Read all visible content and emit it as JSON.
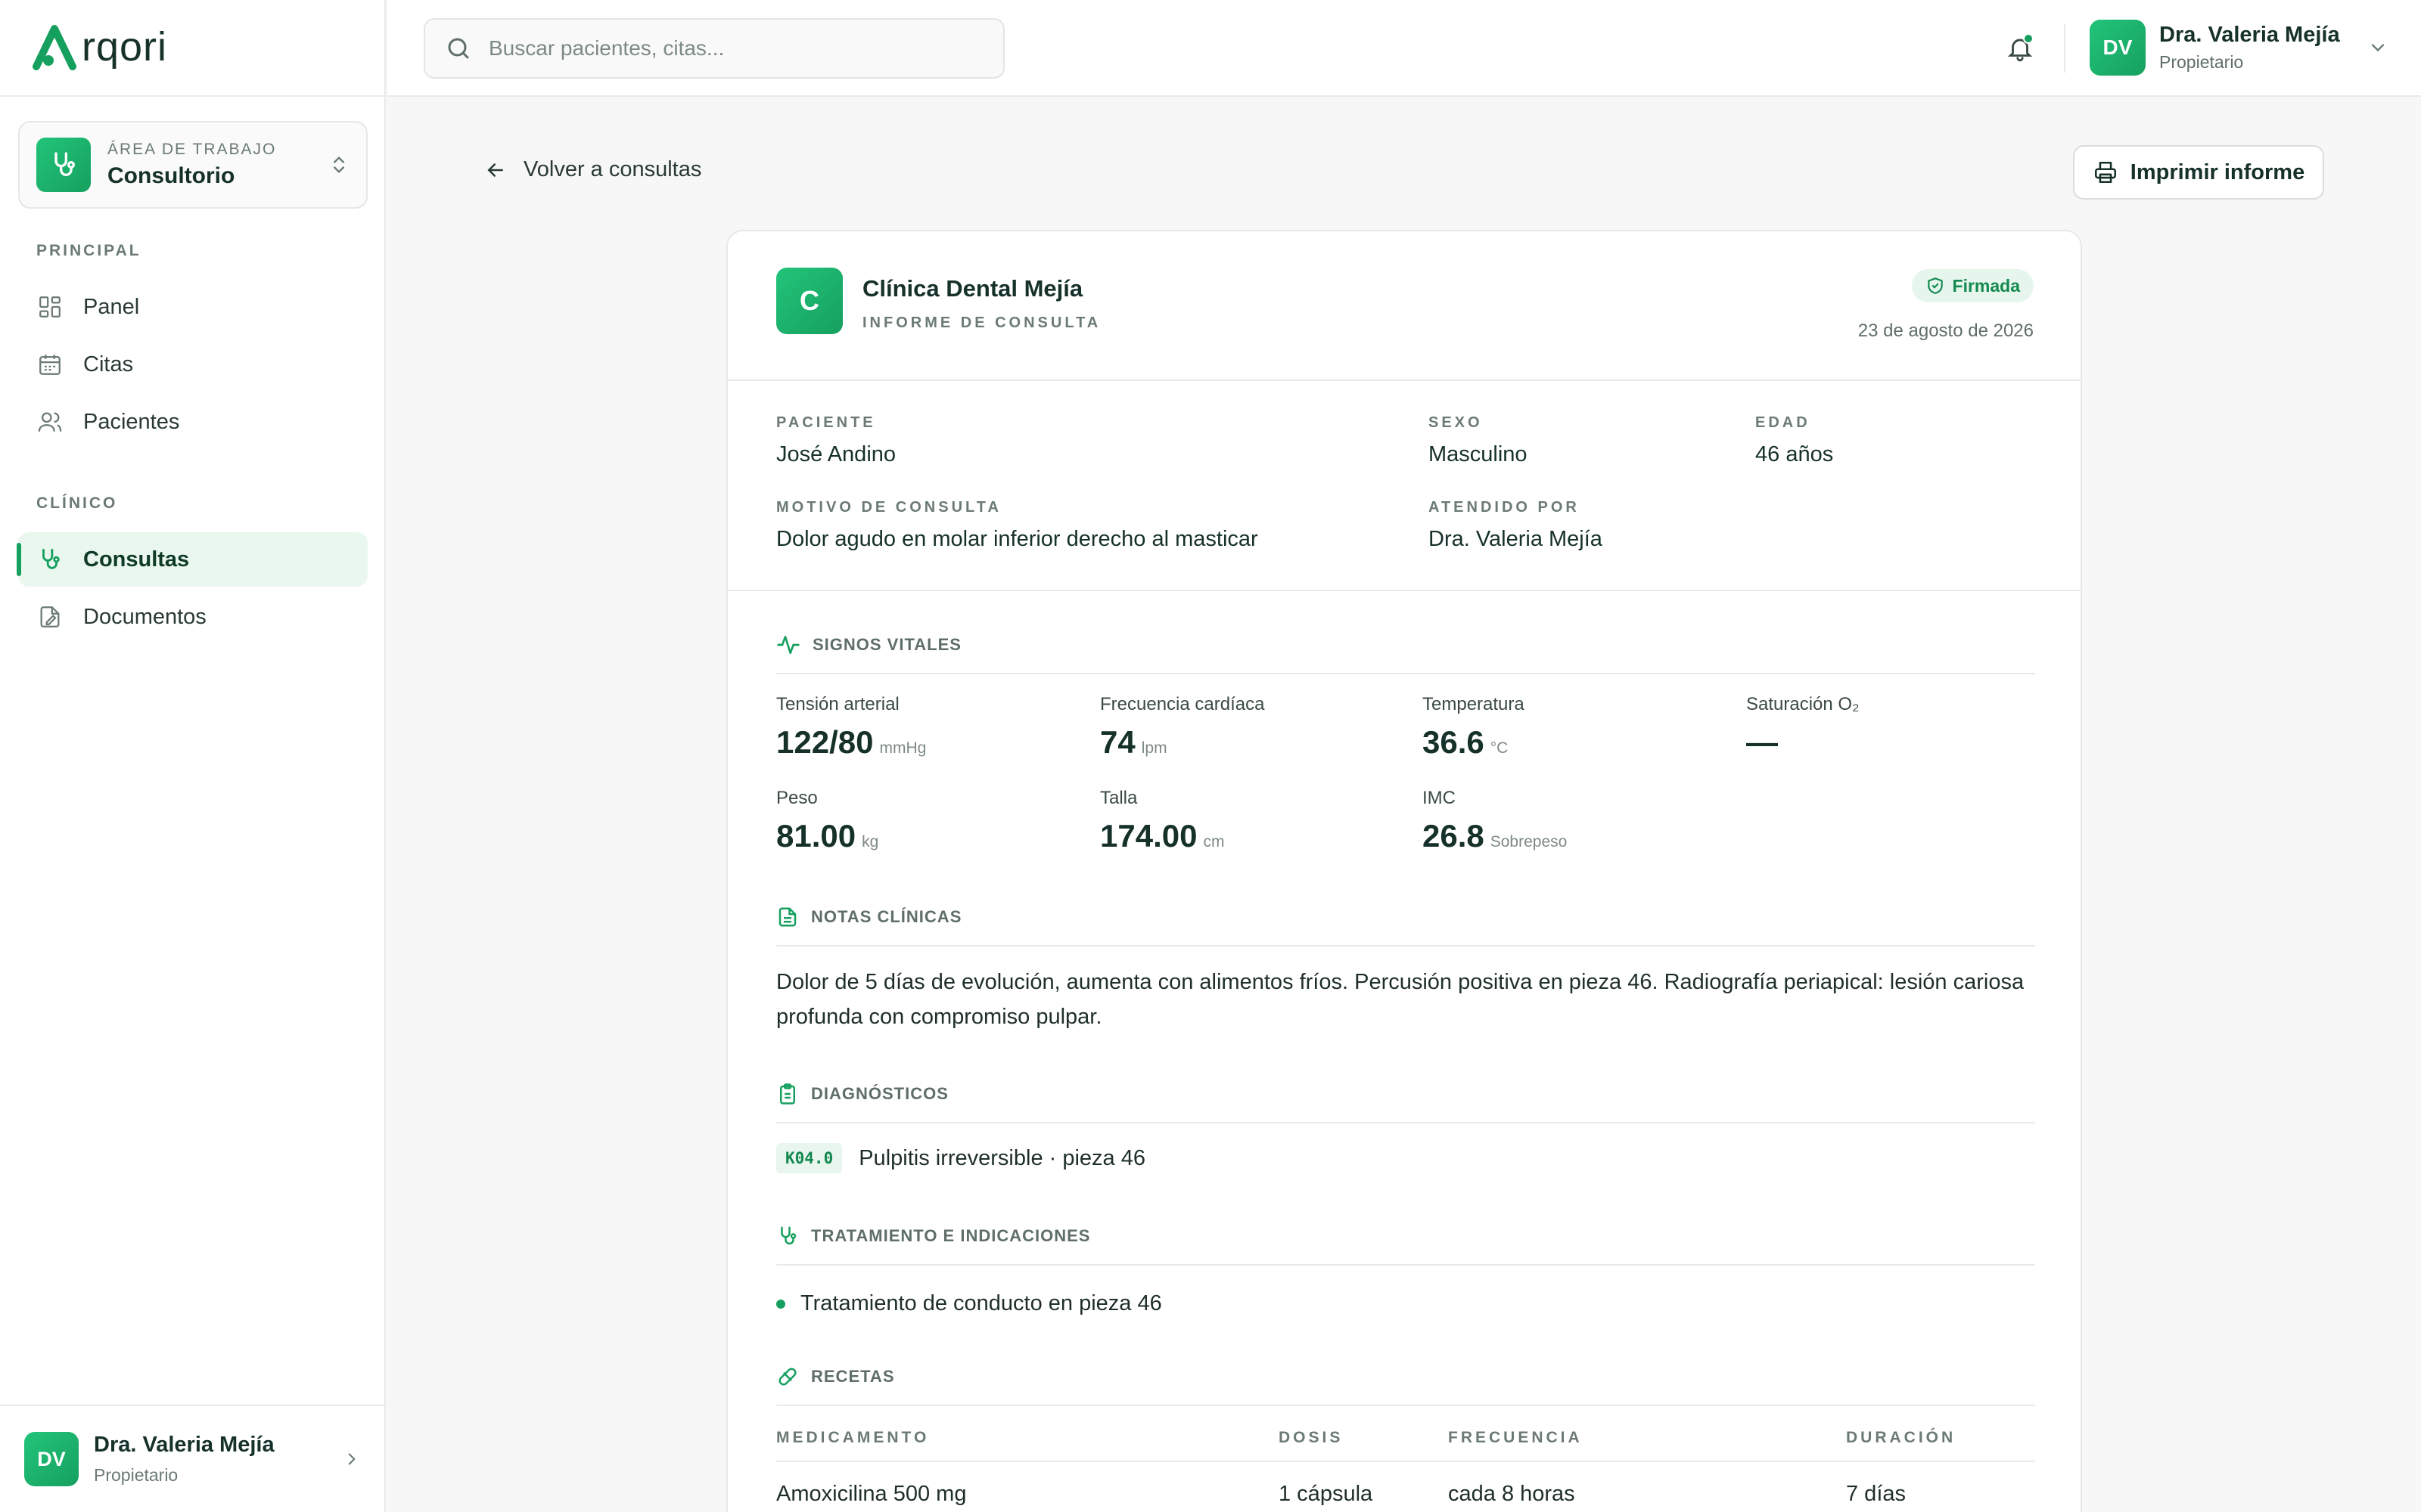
{
  "app": {
    "logo_text": "rqori"
  },
  "sidebar": {
    "workspace": {
      "label": "ÁREA DE TRABAJO",
      "name": "Consultorio"
    },
    "sections": [
      {
        "title": "PRINCIPAL",
        "items": [
          {
            "label": "Panel",
            "icon": "grid-icon"
          },
          {
            "label": "Citas",
            "icon": "calendar-icon"
          },
          {
            "label": "Pacientes",
            "icon": "users-icon"
          }
        ]
      },
      {
        "title": "CLÍNICO",
        "items": [
          {
            "label": "Consultas",
            "icon": "stethoscope-icon",
            "active": true
          },
          {
            "label": "Documentos",
            "icon": "document-edit-icon"
          }
        ]
      }
    ],
    "user": {
      "initials": "DV",
      "name": "Dra. Valeria Mejía",
      "role": "Propietario"
    }
  },
  "topbar": {
    "search_placeholder": "Buscar pacientes, citas...",
    "user": {
      "initials": "DV",
      "name": "Dra. Valeria Mejía",
      "role": "Propietario"
    }
  },
  "page": {
    "back_label": "Volver a consultas",
    "print_label": "Imprimir informe"
  },
  "report": {
    "clinic_initial": "C",
    "clinic_name": "Clínica Dental Mejía",
    "type": "INFORME DE CONSULTA",
    "status": "Firmada",
    "date": "23 de agosto de 2026",
    "patient": {
      "patient_label": "PACIENTE",
      "patient": "José Andino",
      "sex_label": "SEXO",
      "sex": "Masculino",
      "age_label": "EDAD",
      "age": "46 años",
      "reason_label": "MOTIVO DE CONSULTA",
      "reason": "Dolor agudo en molar inferior derecho al masticar",
      "attended_label": "ATENDIDO POR",
      "attended": "Dra. Valeria Mejía"
    },
    "vitals": {
      "title": "SIGNOS VITALES",
      "items": [
        {
          "label": "Tensión arterial",
          "value": "122/80",
          "unit": "mmHg"
        },
        {
          "label": "Frecuencia cardíaca",
          "value": "74",
          "unit": "lpm"
        },
        {
          "label": "Temperatura",
          "value": "36.6",
          "unit": "°C"
        },
        {
          "label": "Saturación O₂",
          "value": "—",
          "unit": ""
        },
        {
          "label": "Peso",
          "value": "81.00",
          "unit": "kg"
        },
        {
          "label": "Talla",
          "value": "174.00",
          "unit": "cm"
        },
        {
          "label": "IMC",
          "value": "26.8",
          "unit": "Sobrepeso"
        }
      ]
    },
    "notes": {
      "title": "NOTAS CLÍNICAS",
      "text": "Dolor de 5 días de evolución, aumenta con alimentos fríos. Percusión positiva en pieza 46. Radiografía periapical: lesión cariosa profunda con compromiso pulpar."
    },
    "diagnoses": {
      "title": "DIAGNÓSTICOS",
      "items": [
        {
          "code": "K04.0",
          "text": "Pulpitis irreversible · pieza 46"
        }
      ]
    },
    "treatment": {
      "title": "TRATAMIENTO E INDICACIONES",
      "items": [
        "Tratamiento de conducto en pieza 46"
      ]
    },
    "prescriptions": {
      "title": "RECETAS",
      "headers": {
        "med": "MEDICAMENTO",
        "dose": "DOSIS",
        "freq": "FRECUENCIA",
        "dur": "DURACIÓN"
      },
      "rows": [
        {
          "med": "Amoxicilina 500 mg",
          "dose": "1 cápsula",
          "freq": "cada 8 horas",
          "dur": "7 días"
        }
      ]
    }
  },
  "colors": {
    "accent": "#16a05f",
    "accent_light": "#e6f6ec",
    "text": "#16302a"
  }
}
